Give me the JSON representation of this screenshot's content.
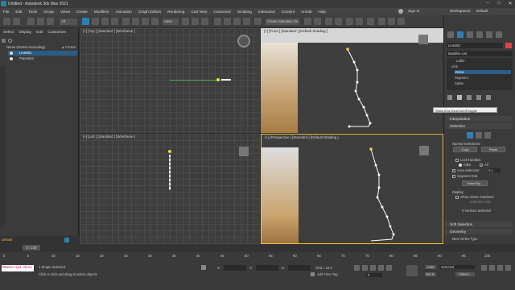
{
  "window": {
    "title": "Untitled - Autodesk 3ds Max 2021",
    "sign_in": "Sign In",
    "workspaces_label": "Workspaces:",
    "workspaces_value": "Default",
    "project_path": "C:\\Users\\Sam...\\3ds Max 2021"
  },
  "menu": [
    "File",
    "Edit",
    "Tools",
    "Group",
    "Views",
    "Create",
    "Modifiers",
    "Animation",
    "Graph Editors",
    "Rendering",
    "Civil View",
    "Customize",
    "Scripting",
    "Interactive",
    "Content",
    "Arnold",
    "Help"
  ],
  "toolbar": {
    "view_dropdown": "View",
    "create_selection_set": "Create Selection Se"
  },
  "explorer": {
    "tabs": [
      "Select",
      "Display",
      "Edit",
      "Customize"
    ],
    "header": "Name (Sorted Ascending)",
    "frozen_header": "▲ Frozen",
    "items": [
      "Line001",
      "Plane001"
    ],
    "layer": "Default"
  },
  "viewports": {
    "top": "[+] [Top ] [Standard ] [Wireframe ]",
    "front": "[+] [Front ] [Standard ] [Default Shading ]",
    "left": "[+] [Left ] [Standard ] [Wireframe ]",
    "perspective": "[+] [Perspective ] [Standard ] [Default Shading ]"
  },
  "command_panel": {
    "object_name": "Line001",
    "modifier_list": "Modifier List",
    "stack": [
      "Lathe",
      "Line",
      "Vertex",
      "Segment",
      "Spline"
    ],
    "tooltip": "Show end result on/off toggle",
    "rollouts": {
      "interpolation": "Interpolation",
      "selection": "Selection",
      "named_selections": "Named Selections:",
      "copy": "Copy",
      "paste": "Paste",
      "lock_handles": "Lock Handles",
      "alike": "Alike",
      "all": "All",
      "area_selection": "Area Selection:",
      "area_value": "0.1",
      "segment_end": "Segment End",
      "select_by": "Select By...",
      "display": "Display",
      "show_vertex_numbers": "Show Vertex Numbers",
      "selected_only": "Selected Only",
      "vertices_selected": "0 Vertices Selected",
      "soft_selection": "Soft Selection",
      "geometry": "Geometry",
      "new_vertex_type": "New Vertex Type"
    }
  },
  "timeline": {
    "frame": "0 / 100",
    "ticks": [
      "0",
      "5",
      "10",
      "15",
      "20",
      "25",
      "30",
      "35",
      "40",
      "45",
      "50",
      "55",
      "60",
      "65",
      "70",
      "75",
      "80",
      "85",
      "90",
      "95",
      "100"
    ]
  },
  "status": {
    "maxscript": "MAXScript Mini",
    "shapes_selected": "1 Shape Selected",
    "prompt": "Click or click-and-drag to select objects",
    "x_label": "X:",
    "y_label": "Y:",
    "z_label": "Z:",
    "grid": "Grid = 10.0",
    "add_time_tag": "Add Time Tag",
    "auto": "Auto",
    "set_key": "Set K.",
    "selected": "Selected",
    "filters": "Filters...",
    "frame_value": "0"
  }
}
